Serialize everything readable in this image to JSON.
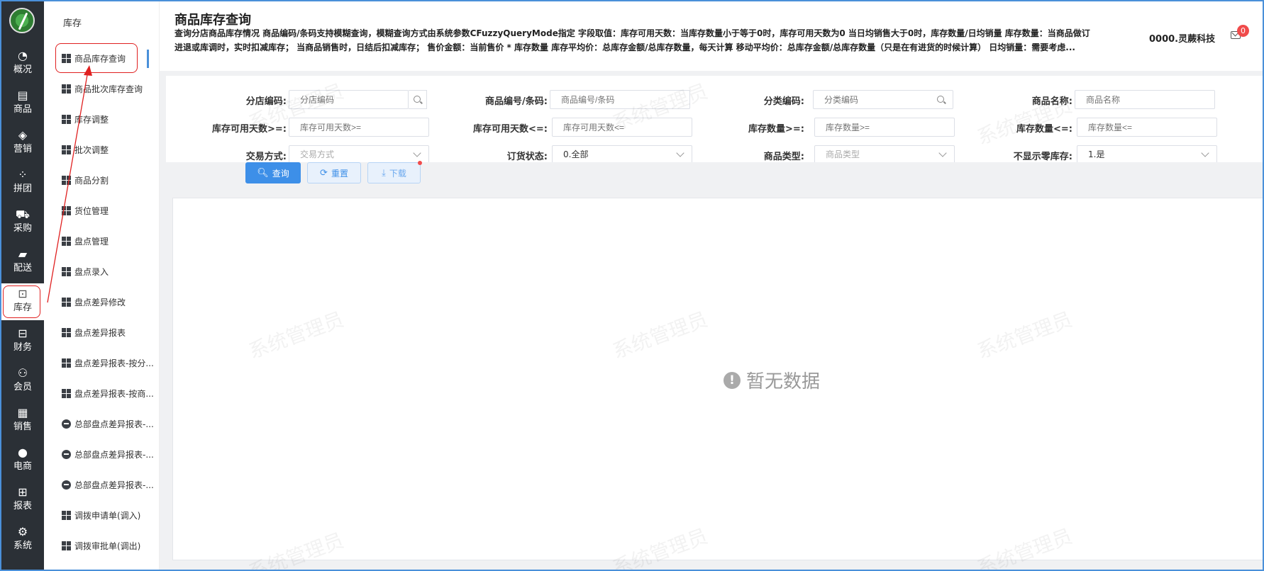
{
  "rail": {
    "items": [
      {
        "label": "概况",
        "icon": "dashboard-icon"
      },
      {
        "label": "商品",
        "icon": "document-icon"
      },
      {
        "label": "营销",
        "icon": "bag-icon"
      },
      {
        "label": "拼团",
        "icon": "grid-circles-icon"
      },
      {
        "label": "采购",
        "icon": "cart-icon"
      },
      {
        "label": "配送",
        "icon": "truck-icon"
      },
      {
        "label": "库存",
        "icon": "box-icon"
      },
      {
        "label": "财务",
        "icon": "money-icon"
      },
      {
        "label": "会员",
        "icon": "user-icon"
      },
      {
        "label": "销售",
        "icon": "register-icon"
      },
      {
        "label": "电商",
        "icon": "person-icon"
      },
      {
        "label": "报表",
        "icon": "report-icon"
      },
      {
        "label": "系统",
        "icon": "gear-icon"
      }
    ],
    "active": "库存"
  },
  "submenu": {
    "title": "库存",
    "items": [
      {
        "label": "商品库存查询",
        "icon": "grid"
      },
      {
        "label": "商品批次库存查询",
        "icon": "grid"
      },
      {
        "label": "库存调整",
        "icon": "grid"
      },
      {
        "label": "批次调整",
        "icon": "grid"
      },
      {
        "label": "商品分割",
        "icon": "grid"
      },
      {
        "label": "货位管理",
        "icon": "grid"
      },
      {
        "label": "盘点管理",
        "icon": "grid"
      },
      {
        "label": "盘点录入",
        "icon": "grid"
      },
      {
        "label": "盘点差异修改",
        "icon": "grid"
      },
      {
        "label": "盘点差异报表",
        "icon": "grid"
      },
      {
        "label": "盘点差异报表-按分...",
        "icon": "grid"
      },
      {
        "label": "盘点差异报表-按商...",
        "icon": "grid"
      },
      {
        "label": "总部盘点差异报表-...",
        "icon": "circle"
      },
      {
        "label": "总部盘点差异报表-...",
        "icon": "circle"
      },
      {
        "label": "总部盘点差异报表-...",
        "icon": "circle"
      },
      {
        "label": "调拨申请单(调入)",
        "icon": "grid"
      },
      {
        "label": "调拨审批单(调出)",
        "icon": "grid"
      }
    ]
  },
  "header": {
    "title": "商品库存查询",
    "description": "查询分店商品库存情况 商品编码/条码支持模糊查询，模糊查询方式由系统参数CFuzzyQueryMode指定 字段取值：库存可用天数：当库存数量小于等于0时，库存可用天数为0 当日均销售大于0时，库存数量/日均销量 库存数量：当商品做订进退或库调时，实时扣减库存； 当商品销售时，日结后扣减库存； 售价金额：当前售价 * 库存数量 库存平均价：总库存金额/总库存数量，每天计算 移动平均价：总库存金额/总库存数量（只是在有进货的时候计算） 日均销量：需要考虑...",
    "company": "0000.灵蕨科技",
    "badge_count": "0"
  },
  "form": {
    "fields": [
      {
        "label": "分店编码:",
        "placeholder": "分店编码",
        "value": ""
      },
      {
        "label": "商品编号/条码:",
        "placeholder": "商品编号/条码",
        "value": ""
      },
      {
        "label": "分类编码:",
        "placeholder": "分类编码",
        "value": ""
      },
      {
        "label": "商品名称:",
        "placeholder": "商品名称",
        "value": ""
      },
      {
        "label": "库存可用天数>=:",
        "placeholder": "库存可用天数>=",
        "value": ""
      },
      {
        "label": "库存可用天数<=:",
        "placeholder": "库存可用天数<=",
        "value": ""
      },
      {
        "label": "库存数量>=:",
        "placeholder": "库存数量>=",
        "value": ""
      },
      {
        "label": "库存数量<=:",
        "placeholder": "库存数量<=",
        "value": ""
      },
      {
        "label": "交易方式:",
        "placeholder": "交易方式",
        "value": ""
      },
      {
        "label": "订货状态:",
        "placeholder": "",
        "value": "0.全部"
      },
      {
        "label": "商品类型:",
        "placeholder": "商品类型",
        "value": ""
      },
      {
        "label": "不显示零库存:",
        "placeholder": "",
        "value": "1.是"
      }
    ]
  },
  "buttons": {
    "query": "查询",
    "reset": "重置",
    "download": "下载"
  },
  "table": {
    "empty_text": "暂无数据"
  },
  "watermark": "系统管理员"
}
